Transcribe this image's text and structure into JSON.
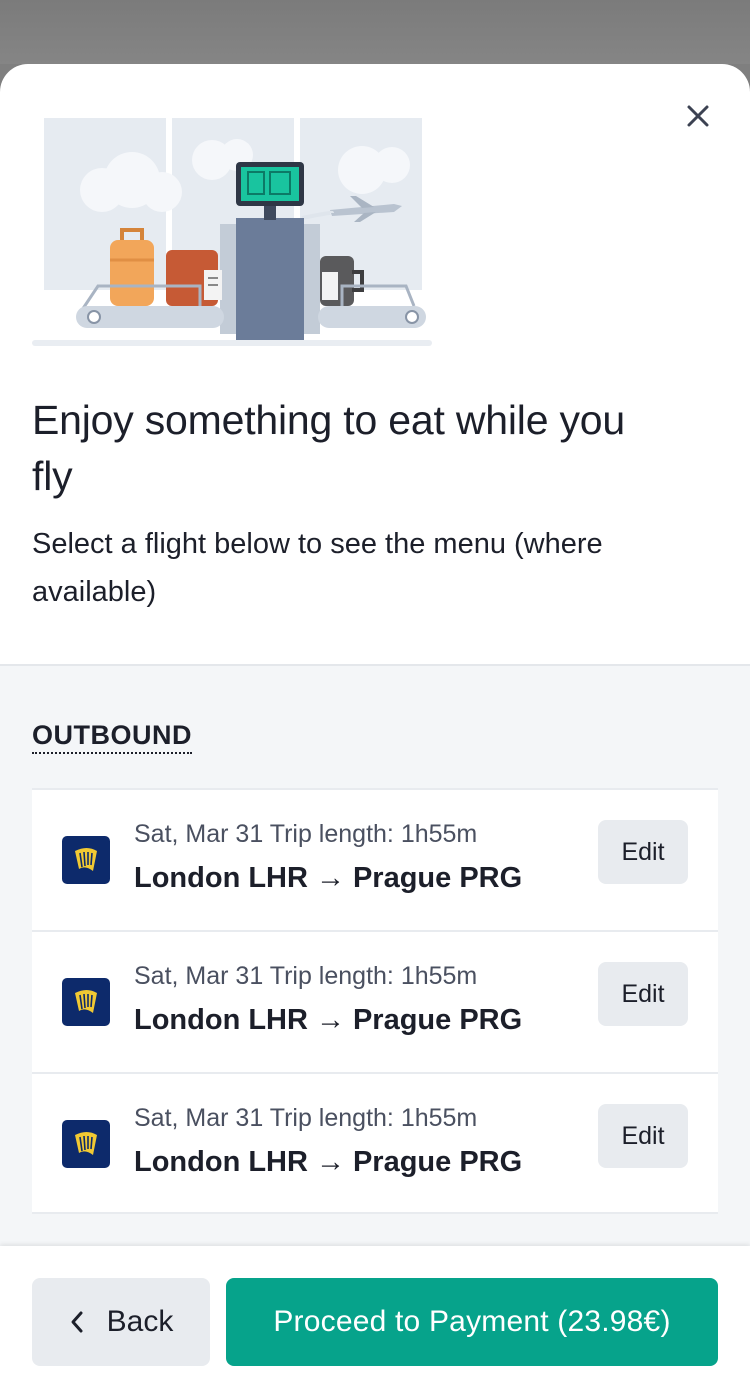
{
  "dialog": {
    "title": "Enjoy something to eat while you fly",
    "subtitle": "Select a flight below to see the menu (where available)",
    "close_icon": "close-icon",
    "hero_image": "baggage-conveyor-airport-illustration"
  },
  "section": {
    "label": "OUTBOUND"
  },
  "flights": [
    {
      "date": "Sat, Mar 31",
      "trip_length_label": "Trip length: 1h55m",
      "origin": "London LHR",
      "arrow": "→",
      "destination": "Prague PRG",
      "edit_label": "Edit",
      "airline_icon": "ryanair-harp-logo"
    },
    {
      "date": "Sat, Mar 31",
      "trip_length_label": "Trip length: 1h55m",
      "origin": "London LHR",
      "arrow": "→",
      "destination": "Prague PRG",
      "edit_label": "Edit",
      "airline_icon": "ryanair-harp-logo"
    },
    {
      "date": "Sat, Mar 31",
      "trip_length_label": "Trip length: 1h55m",
      "origin": "London LHR",
      "arrow": "→",
      "destination": "Prague PRG",
      "edit_label": "Edit",
      "airline_icon": "ryanair-harp-logo"
    }
  ],
  "footer": {
    "back_label": "Back",
    "back_icon": "chevron-left-icon",
    "proceed_label": "Proceed to Payment (23.98€)"
  },
  "colors": {
    "accent": "#06a38b",
    "text": "#1c1f2a",
    "secondary_button": "#e8ebef",
    "list_background": "#f4f6f8",
    "airline_logo": "#0d2a6b",
    "airline_logo_accent": "#f1c933"
  }
}
